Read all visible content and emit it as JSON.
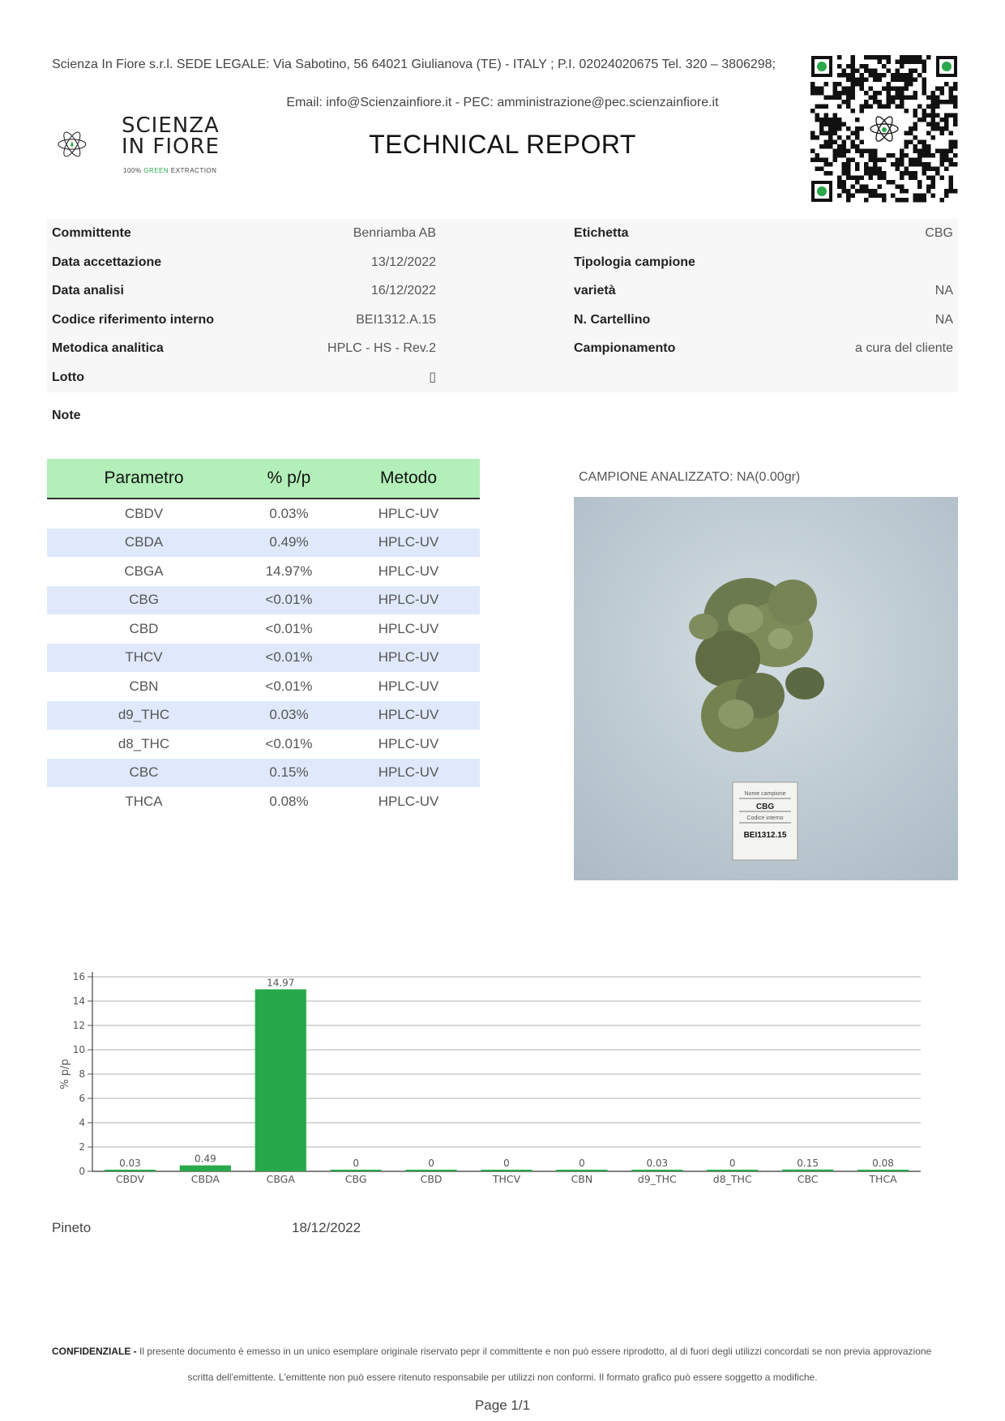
{
  "header": {
    "company_line": "Scienza In Fiore s.r.l. SEDE LEGALE: Via Sabotino, 56 64021 Giulianova (TE) - ITALY ; P.I. 02024020675 Tel. 320 – 3806298;",
    "email_line": "Email: info@Scienzainfiore.it - PEC: amministrazione@pec.scienzainfiore.it",
    "title": "TECHNICAL REPORT",
    "logo": {
      "line1": "SCIENZA",
      "line2": "IN FIORE",
      "tag_a": "100% ",
      "tag_green": "GREEN",
      "tag_b": " EXTRACTION"
    }
  },
  "info": {
    "left": [
      {
        "label": "Committente",
        "value": "Benriamba AB"
      },
      {
        "label": "Data accettazione",
        "value": "13/12/2022"
      },
      {
        "label": "Data analisi",
        "value": "16/12/2022"
      },
      {
        "label": "Codice riferimento interno",
        "value": "BEI1312.A.15"
      },
      {
        "label": "Metodica analitica",
        "value": "HPLC - HS - Rev.2"
      },
      {
        "label": "Lotto",
        "value": "▯"
      }
    ],
    "right": [
      {
        "label": "Etichetta",
        "value": "CBG"
      },
      {
        "label": "Tipologia campione",
        "value": ""
      },
      {
        "label": "varietà",
        "value": "NA"
      },
      {
        "label": "N. Cartellino",
        "value": "NA"
      },
      {
        "label": "Campionamento",
        "value": "a cura del cliente"
      }
    ],
    "note_label": "Note"
  },
  "results": {
    "headers": [
      "Parametro",
      "% p/p",
      "Metodo"
    ],
    "rows": [
      [
        "CBDV",
        "0.03%",
        "HPLC-UV"
      ],
      [
        "CBDA",
        "0.49%",
        "HPLC-UV"
      ],
      [
        "CBGA",
        "14.97%",
        "HPLC-UV"
      ],
      [
        "CBG",
        "<0.01%",
        "HPLC-UV"
      ],
      [
        "CBD",
        "<0.01%",
        "HPLC-UV"
      ],
      [
        "THCV",
        "<0.01%",
        "HPLC-UV"
      ],
      [
        "CBN",
        "<0.01%",
        "HPLC-UV"
      ],
      [
        "d9_THC",
        "0.03%",
        "HPLC-UV"
      ],
      [
        "d8_THC",
        "<0.01%",
        "HPLC-UV"
      ],
      [
        "CBC",
        "0.15%",
        "HPLC-UV"
      ],
      [
        "THCA",
        "0.08%",
        "HPLC-UV"
      ]
    ]
  },
  "sample": {
    "caption": "CAMPIONE ANALIZZATO: NA(0.00gr)",
    "label_card": {
      "line1": "Nome campione",
      "line2": "CBG",
      "line3": "Codice interno",
      "line4": "BEI1312.15"
    }
  },
  "chart_data": {
    "type": "bar",
    "categories": [
      "CBDV",
      "CBDA",
      "CBGA",
      "CBG",
      "CBD",
      "THCV",
      "CBN",
      "d9_THC",
      "d8_THC",
      "CBC",
      "THCA"
    ],
    "values": [
      0.03,
      0.49,
      14.97,
      0,
      0,
      0,
      0,
      0.03,
      0,
      0.15,
      0.08
    ],
    "data_labels": [
      "0.03",
      "0.49",
      "14.97",
      "0",
      "0",
      "0",
      "0",
      "0.03",
      "0",
      "0.15",
      "0.08"
    ],
    "ylabel": "% p/p",
    "xlabel": "",
    "ylim": [
      0,
      16
    ],
    "yticks": [
      0,
      2,
      4,
      6,
      8,
      10,
      12,
      14,
      16
    ],
    "grid": true,
    "bar_color": "#27a84a"
  },
  "signature": {
    "place": "Pineto",
    "date": "18/12/2022"
  },
  "footer": {
    "confidential_label": "CONFIDENZIALE -",
    "confidential_text": " Il presente documento è emesso in un unico esemplare originale riservato pepr il committente e non può essere riprodotto, al di fuori degli utilizzi concordati se non previa approvazione",
    "confidential_text2": "scritta dell'emittente. L'emittente non può essere ritenuto responsabile per utilizzi non conformi. Il formato grafico può essere soggetto a modifiche.",
    "page": "Page 1/1"
  },
  "colors": {
    "table_header": "#b3efb9",
    "row_alt": "#dfe9fb",
    "bar": "#27a84a",
    "info_bg": "#f7f7f7"
  }
}
